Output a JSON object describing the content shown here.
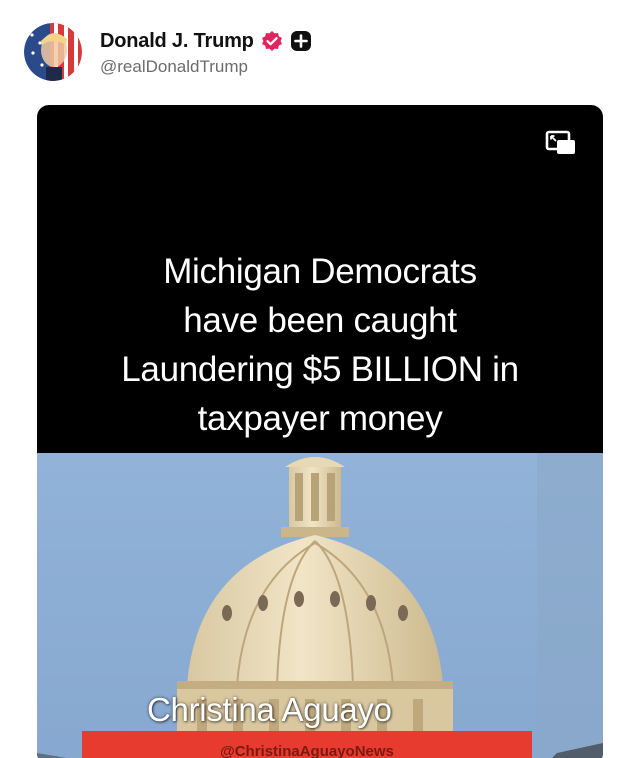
{
  "author": {
    "display_name": "Donald J. Trump",
    "handle": "@realDonaldTrump",
    "verified_icon": "verified-badge-icon",
    "follow_icon": "follow-plus-icon",
    "avatar_icon": "avatar-image"
  },
  "media": {
    "headline": [
      "Michigan Democrats",
      "have been caught",
      "Laundering $5 BILLION in",
      "taxpayer money"
    ],
    "pip_icon": "picture-in-picture-icon",
    "watermark_name": "Christina Aguayo",
    "watermark_handle": "@ChristinaAguayoNews",
    "colors": {
      "background": "#000000",
      "sky": "#8fb0d6",
      "dome": "#e7d8b4",
      "watermark_bar": "#e63b2e",
      "verified": "#e0245e"
    }
  }
}
